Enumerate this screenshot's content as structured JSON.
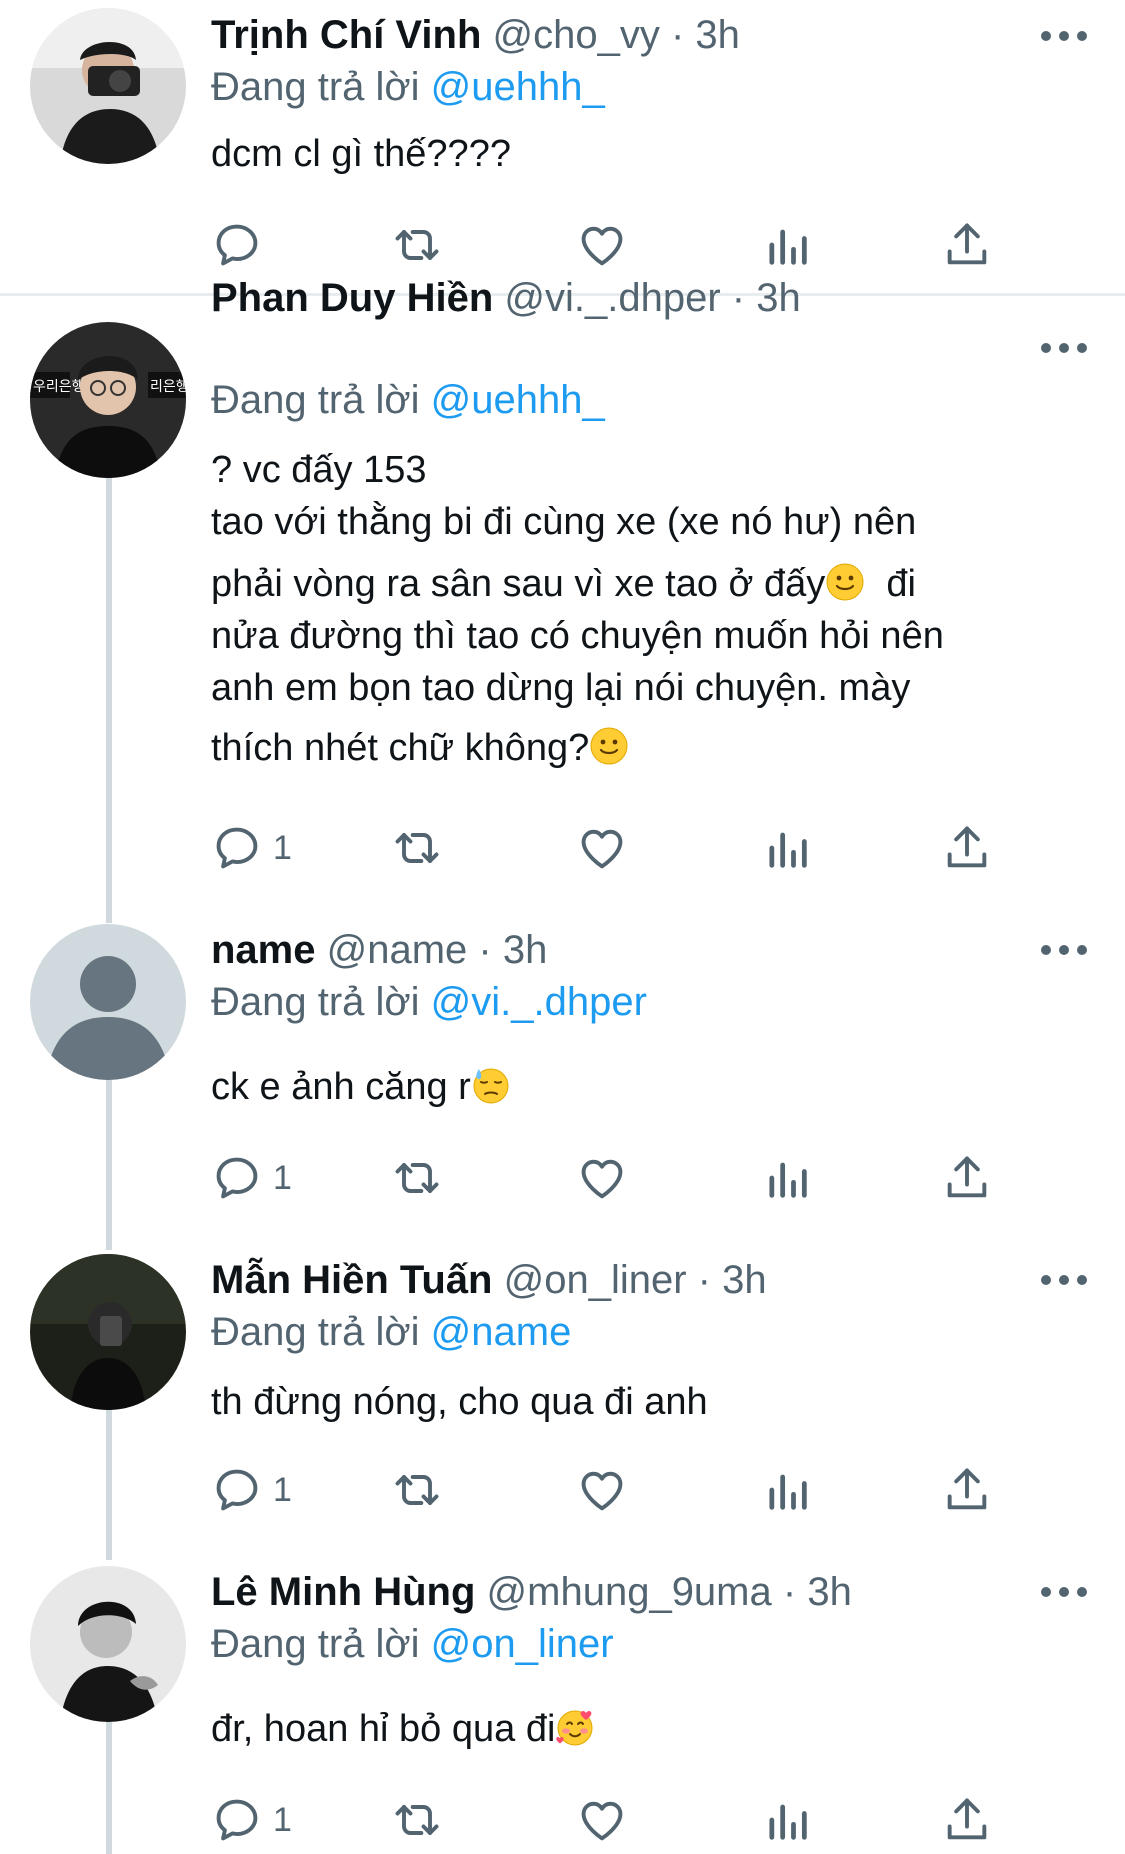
{
  "colors": {
    "accent": "#1d9bf0",
    "muted": "#536471",
    "text": "#0f1419",
    "thread_line": "#cfd9de"
  },
  "tweets": [
    {
      "name": "Trịnh Chí Vinh",
      "handle": "@cho_vy",
      "dot": "·",
      "time": "3h",
      "reply_label": "Đang trả lời",
      "reply_to": "@uehhh_",
      "lines": [
        "dcm cl gì thế????"
      ],
      "reply_count": ""
    },
    {
      "name": "Phan Duy Hiền",
      "handle": "@vi._.dhper",
      "dot": "·",
      "time": "3h",
      "reply_label": "Đang trả lời",
      "reply_to": "@uehhh_",
      "lines": [
        "? vc đấy 153",
        "tao với thằng bi đi cùng xe (xe nó hư) nên",
        "phải vòng ra sân sau vì xe tao ở đấy",
        "đi",
        "nửa đường thì tao có chuyện muốn hỏi nên",
        "anh em bọn tao dừng lại nói chuyện. mày",
        "thích nhét chữ không?"
      ],
      "reply_count": "1"
    },
    {
      "name": "name",
      "handle": "@name",
      "dot": "·",
      "time": "3h",
      "reply_label": "Đang trả lời",
      "reply_to": "@vi._.dhper",
      "lines": [
        "ck e ảnh căng r"
      ],
      "reply_count": "1"
    },
    {
      "name": "Mẫn Hiền Tuấn",
      "handle": "@on_liner",
      "dot": "·",
      "time": "3h",
      "reply_label": "Đang trả lời",
      "reply_to": "@name",
      "lines": [
        "th đừng nóng, cho qua đi anh"
      ],
      "reply_count": "1"
    },
    {
      "name": "Lê Minh Hùng",
      "handle": "@mhung_9uma",
      "dot": "·",
      "time": "3h",
      "reply_label": "Đang trả lời",
      "reply_to": "@on_liner",
      "lines": [
        "đr, hoan hỉ bỏ qua đi"
      ],
      "reply_count": "1"
    }
  ],
  "icons": [
    "reply-icon",
    "retweet-icon",
    "like-icon",
    "analytics-icon",
    "share-icon",
    "more-icon",
    "slightly-smiling-face-emoji",
    "sweat-face-emoji",
    "smiling-face-with-hearts-emoji"
  ]
}
